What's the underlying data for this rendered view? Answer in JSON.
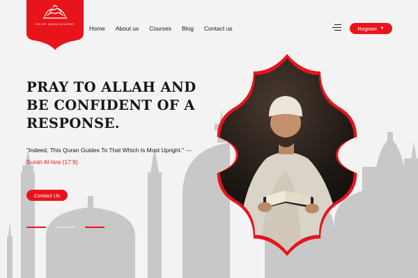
{
  "brand": {
    "logo_label": "Quran Academy logo",
    "caption": "ONLINE QURAN ACADEMY"
  },
  "nav": {
    "items": [
      {
        "label": "Home"
      },
      {
        "label": "About us"
      },
      {
        "label": "Courses"
      },
      {
        "label": "Blog"
      },
      {
        "label": "Contact us"
      }
    ],
    "register_label": "Register"
  },
  "hero": {
    "headline_line1": "PRAY TO ALLAH AND",
    "headline_line2": "BE CONFIDENT OF A",
    "headline_line3": "RESPONSE.",
    "quote_text": "\"Indeed, This Quran Guides To That Which Is Most Upright.\"",
    "quote_reference": "— Surah Al-Isra (17:9)",
    "cta_label": "Contact Us",
    "slides": [
      {
        "active": true
      },
      {
        "active": false
      },
      {
        "active": true
      }
    ],
    "photo_alt": "Man in white cap reading the Quran"
  },
  "colors": {
    "accent": "#e8141c",
    "background": "#f4f3f3",
    "silhouette": "#c7c6c6",
    "text": "#151515"
  },
  "icons": {
    "menu": "hamburger-menu-icon",
    "dropdown": "caret-down-icon"
  }
}
